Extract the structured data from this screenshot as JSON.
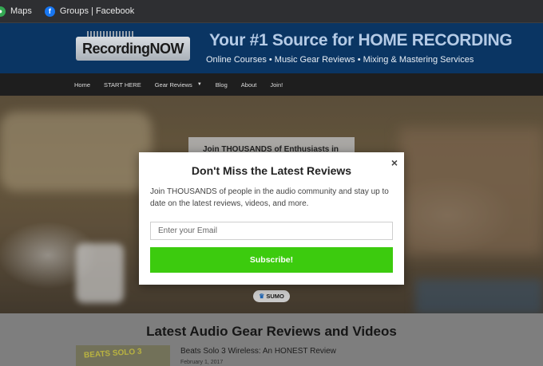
{
  "bookmarks": [
    {
      "label": "Maps",
      "icon": "maps-icon"
    },
    {
      "label": "Groups | Facebook",
      "icon": "facebook-icon"
    }
  ],
  "header": {
    "logo_text": "RecordingNOW",
    "tagline": "Your #1 Source for HOME RECORDING",
    "subtagline": "Online Courses • Music Gear Reviews • Mixing & Mastering Services"
  },
  "nav": {
    "items": [
      "Home",
      "START HERE",
      "Gear Reviews",
      "Blog",
      "About",
      "Join!"
    ]
  },
  "hero": {
    "join_text": "Join THOUSANDS of Enthusiasts in",
    "sumo_label": "SUMO"
  },
  "content": {
    "section_title": "Latest Audio Gear Reviews and Videos",
    "thumb_text": "BEATS SOLO 3",
    "post_title": "Beats Solo 3 Wireless: An HONEST Review",
    "post_date": "February 1, 2017"
  },
  "modal": {
    "title": "Don't Miss the Latest Reviews",
    "body": "Join THOUSANDS of people in the audio community and stay up to date on the latest reviews, videos, and more.",
    "email_placeholder": "Enter your Email",
    "subscribe_label": "Subscribe!",
    "close_symbol": "×"
  },
  "colors": {
    "header_bg": "#0a3563",
    "subscribe_green": "#3ccb0e",
    "nav_bg": "#1e1e1e"
  }
}
